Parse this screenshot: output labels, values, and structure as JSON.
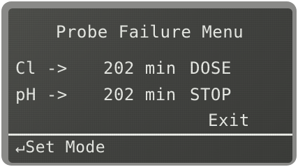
{
  "menu": {
    "title": "Probe Failure Menu",
    "rows": [
      {
        "label": "Cl ->",
        "value": "202 min",
        "status": "DOSE"
      },
      {
        "label": "pH ->",
        "value": "202 min",
        "status": "STOP"
      }
    ],
    "exit_label": "Exit"
  },
  "footer": {
    "hint": "↵Set Mode"
  },
  "colors": {
    "screen_bg": "#434441",
    "text": "#e9ebe6",
    "bezel": "#8a8a88"
  }
}
